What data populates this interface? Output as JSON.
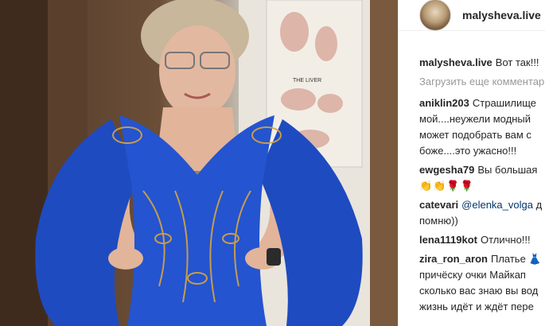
{
  "post": {
    "author": "malysheva.live",
    "caption": "Вот так!!!",
    "load_more": "Загрузить еще комментарии"
  },
  "comments": [
    {
      "user": "aniklin203",
      "lines": [
        "Страшилище",
        "мой....неужели модный",
        "может подобрать вам с",
        "боже....это ужасно!!!"
      ]
    },
    {
      "user": "ewgesha79",
      "lines": [
        "Вы большая",
        "👏👏🌹🌹"
      ]
    },
    {
      "user": "catevari",
      "mention": "@elenka_volga",
      "lines": [
        "д",
        "помню))"
      ]
    },
    {
      "user": "lena1119kot",
      "lines": [
        "Отлично!!!"
      ]
    },
    {
      "user": "zira_ron_aron",
      "lines": [
        "Платье 👗",
        "причёску очки Майкап",
        "сколько вас знаю вы вод",
        "жизнь идёт и ждёт пере"
      ]
    }
  ],
  "colors": {
    "dress": "#1f4bc0",
    "text": "#262626",
    "muted": "#999999",
    "link": "#003569"
  }
}
